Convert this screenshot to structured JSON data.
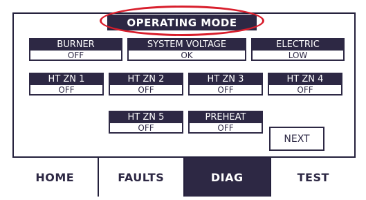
{
  "title": "OPERATING MODE",
  "status_tiles": [
    {
      "label": "BURNER",
      "value": "OFF"
    },
    {
      "label": "SYSTEM VOLTAGE",
      "value": "OK"
    },
    {
      "label": "ELECTRIC",
      "value": "LOW"
    },
    {
      "label": "HT ZN 1",
      "value": "OFF"
    },
    {
      "label": "HT ZN 2",
      "value": "OFF"
    },
    {
      "label": "HT ZN 3",
      "value": "OFF"
    },
    {
      "label": "HT ZN 4",
      "value": "OFF"
    },
    {
      "label": "HT ZN 5",
      "value": "OFF"
    },
    {
      "label": "PREHEAT",
      "value": "OFF"
    }
  ],
  "next_label": "NEXT",
  "tabs": [
    {
      "label": "HOME",
      "active": false
    },
    {
      "label": "FAULTS",
      "active": false
    },
    {
      "label": "DIAG",
      "active": true
    },
    {
      "label": "TEST",
      "active": false
    }
  ],
  "colors": {
    "panel_dark": "#2d2844",
    "highlight_ring": "#d81e2c",
    "background": "#ffffff"
  }
}
